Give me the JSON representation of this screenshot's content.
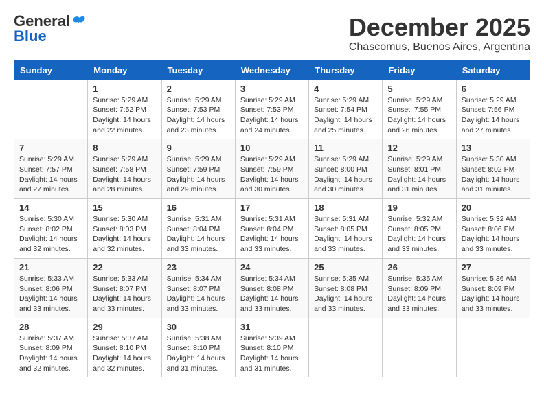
{
  "logo": {
    "general": "General",
    "blue": "Blue"
  },
  "title": "December 2025",
  "subtitle": "Chascomus, Buenos Aires, Argentina",
  "days_header": [
    "Sunday",
    "Monday",
    "Tuesday",
    "Wednesday",
    "Thursday",
    "Friday",
    "Saturday"
  ],
  "weeks": [
    [
      {
        "day": "",
        "info": ""
      },
      {
        "day": "1",
        "info": "Sunrise: 5:29 AM\nSunset: 7:52 PM\nDaylight: 14 hours\nand 22 minutes."
      },
      {
        "day": "2",
        "info": "Sunrise: 5:29 AM\nSunset: 7:53 PM\nDaylight: 14 hours\nand 23 minutes."
      },
      {
        "day": "3",
        "info": "Sunrise: 5:29 AM\nSunset: 7:53 PM\nDaylight: 14 hours\nand 24 minutes."
      },
      {
        "day": "4",
        "info": "Sunrise: 5:29 AM\nSunset: 7:54 PM\nDaylight: 14 hours\nand 25 minutes."
      },
      {
        "day": "5",
        "info": "Sunrise: 5:29 AM\nSunset: 7:55 PM\nDaylight: 14 hours\nand 26 minutes."
      },
      {
        "day": "6",
        "info": "Sunrise: 5:29 AM\nSunset: 7:56 PM\nDaylight: 14 hours\nand 27 minutes."
      }
    ],
    [
      {
        "day": "7",
        "info": "Sunrise: 5:29 AM\nSunset: 7:57 PM\nDaylight: 14 hours\nand 27 minutes."
      },
      {
        "day": "8",
        "info": "Sunrise: 5:29 AM\nSunset: 7:58 PM\nDaylight: 14 hours\nand 28 minutes."
      },
      {
        "day": "9",
        "info": "Sunrise: 5:29 AM\nSunset: 7:59 PM\nDaylight: 14 hours\nand 29 minutes."
      },
      {
        "day": "10",
        "info": "Sunrise: 5:29 AM\nSunset: 7:59 PM\nDaylight: 14 hours\nand 30 minutes."
      },
      {
        "day": "11",
        "info": "Sunrise: 5:29 AM\nSunset: 8:00 PM\nDaylight: 14 hours\nand 30 minutes."
      },
      {
        "day": "12",
        "info": "Sunrise: 5:29 AM\nSunset: 8:01 PM\nDaylight: 14 hours\nand 31 minutes."
      },
      {
        "day": "13",
        "info": "Sunrise: 5:30 AM\nSunset: 8:02 PM\nDaylight: 14 hours\nand 31 minutes."
      }
    ],
    [
      {
        "day": "14",
        "info": "Sunrise: 5:30 AM\nSunset: 8:02 PM\nDaylight: 14 hours\nand 32 minutes."
      },
      {
        "day": "15",
        "info": "Sunrise: 5:30 AM\nSunset: 8:03 PM\nDaylight: 14 hours\nand 32 minutes."
      },
      {
        "day": "16",
        "info": "Sunrise: 5:31 AM\nSunset: 8:04 PM\nDaylight: 14 hours\nand 33 minutes."
      },
      {
        "day": "17",
        "info": "Sunrise: 5:31 AM\nSunset: 8:04 PM\nDaylight: 14 hours\nand 33 minutes."
      },
      {
        "day": "18",
        "info": "Sunrise: 5:31 AM\nSunset: 8:05 PM\nDaylight: 14 hours\nand 33 minutes."
      },
      {
        "day": "19",
        "info": "Sunrise: 5:32 AM\nSunset: 8:05 PM\nDaylight: 14 hours\nand 33 minutes."
      },
      {
        "day": "20",
        "info": "Sunrise: 5:32 AM\nSunset: 8:06 PM\nDaylight: 14 hours\nand 33 minutes."
      }
    ],
    [
      {
        "day": "21",
        "info": "Sunrise: 5:33 AM\nSunset: 8:06 PM\nDaylight: 14 hours\nand 33 minutes."
      },
      {
        "day": "22",
        "info": "Sunrise: 5:33 AM\nSunset: 8:07 PM\nDaylight: 14 hours\nand 33 minutes."
      },
      {
        "day": "23",
        "info": "Sunrise: 5:34 AM\nSunset: 8:07 PM\nDaylight: 14 hours\nand 33 minutes."
      },
      {
        "day": "24",
        "info": "Sunrise: 5:34 AM\nSunset: 8:08 PM\nDaylight: 14 hours\nand 33 minutes."
      },
      {
        "day": "25",
        "info": "Sunrise: 5:35 AM\nSunset: 8:08 PM\nDaylight: 14 hours\nand 33 minutes."
      },
      {
        "day": "26",
        "info": "Sunrise: 5:35 AM\nSunset: 8:09 PM\nDaylight: 14 hours\nand 33 minutes."
      },
      {
        "day": "27",
        "info": "Sunrise: 5:36 AM\nSunset: 8:09 PM\nDaylight: 14 hours\nand 33 minutes."
      }
    ],
    [
      {
        "day": "28",
        "info": "Sunrise: 5:37 AM\nSunset: 8:09 PM\nDaylight: 14 hours\nand 32 minutes."
      },
      {
        "day": "29",
        "info": "Sunrise: 5:37 AM\nSunset: 8:10 PM\nDaylight: 14 hours\nand 32 minutes."
      },
      {
        "day": "30",
        "info": "Sunrise: 5:38 AM\nSunset: 8:10 PM\nDaylight: 14 hours\nand 31 minutes."
      },
      {
        "day": "31",
        "info": "Sunrise: 5:39 AM\nSunset: 8:10 PM\nDaylight: 14 hours\nand 31 minutes."
      },
      {
        "day": "",
        "info": ""
      },
      {
        "day": "",
        "info": ""
      },
      {
        "day": "",
        "info": ""
      }
    ]
  ]
}
